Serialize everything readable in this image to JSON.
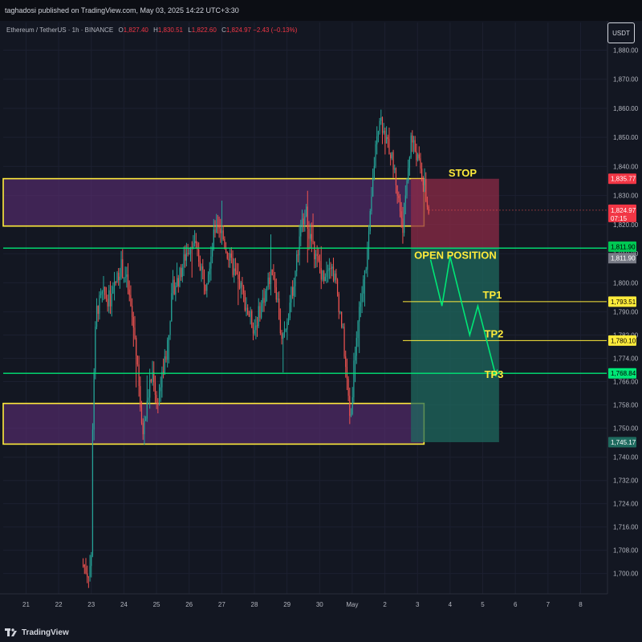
{
  "publisher": "taghadosi published on TradingView.com, May 03, 2025 14:22 UTC+3:30",
  "symbol": {
    "name": "Ethereum / TetherUS · 1h · BINANCE",
    "open_label": "O",
    "open": "1,827.40",
    "high_label": "H",
    "high": "1,830.51",
    "low_label": "L",
    "low": "1,822.60",
    "close_label": "C",
    "close": "1,824.97",
    "change": "−2.43 (−0.13%)"
  },
  "currency_button": "USDT",
  "brand": "TradingView",
  "colors": {
    "up": "#26a69a",
    "down": "#ef5350",
    "zone_purple": "#5b2d73",
    "zone_border": "#ffeb3b",
    "green_line": "#00e676",
    "stop_fill": "#8e2b47",
    "target_fill": "#1f6b5f",
    "annotation": "#ffeb3b"
  },
  "chart_data": {
    "type": "candlestick",
    "ylim": [
      1693,
      1884
    ],
    "y_ticks": [
      "1,700.00",
      "1,708.00",
      "1,716.00",
      "1,724.00",
      "1,732.00",
      "1,740.00",
      "1,750.00",
      "1,758.00",
      "1,766.00",
      "1,774.00",
      "1,782.00",
      "1,790.00",
      "1,800.00",
      "1,810.00",
      "1,820.00",
      "1,830.00",
      "1,840.00",
      "1,850.00",
      "1,860.00",
      "1,870.00",
      "1,880.00"
    ],
    "x_ticks": [
      "21",
      "22",
      "23",
      "24",
      "25",
      "26",
      "27",
      "28",
      "29",
      "30",
      "May",
      "2",
      "3",
      "4",
      "5",
      "6",
      "7",
      "8"
    ],
    "x_range": [
      20.3,
      38.8
    ],
    "x_tick_positions": [
      21,
      22,
      23,
      24,
      25,
      26,
      27,
      28,
      29,
      30,
      31,
      32,
      33,
      34,
      35,
      36,
      37,
      38
    ],
    "candles": {
      "start_day": 22.75,
      "step_days": 0.0417,
      "path": [
        [
          22.75,
          1703
        ],
        [
          22.9,
          1700
        ],
        [
          23.0,
          1705
        ],
        [
          23.05,
          1760
        ],
        [
          23.15,
          1790
        ],
        [
          23.35,
          1796
        ],
        [
          23.6,
          1794
        ],
        [
          23.9,
          1806
        ],
        [
          24.1,
          1800
        ],
        [
          24.2,
          1792
        ],
        [
          24.35,
          1780
        ],
        [
          24.45,
          1768
        ],
        [
          24.55,
          1748
        ],
        [
          24.65,
          1752
        ],
        [
          24.75,
          1762
        ],
        [
          24.9,
          1770
        ],
        [
          25.0,
          1758
        ],
        [
          25.15,
          1766
        ],
        [
          25.3,
          1776
        ],
        [
          25.5,
          1798
        ],
        [
          25.7,
          1802
        ],
        [
          25.9,
          1810
        ],
        [
          26.1,
          1815
        ],
        [
          26.3,
          1808
        ],
        [
          26.5,
          1800
        ],
        [
          26.7,
          1812
        ],
        [
          26.85,
          1822
        ],
        [
          27.0,
          1817
        ],
        [
          27.2,
          1809
        ],
        [
          27.4,
          1803
        ],
        [
          27.6,
          1798
        ],
        [
          27.8,
          1790
        ],
        [
          28.0,
          1784
        ],
        [
          28.2,
          1792
        ],
        [
          28.4,
          1799
        ],
        [
          28.55,
          1805
        ],
        [
          28.7,
          1795
        ],
        [
          28.85,
          1778
        ],
        [
          29.0,
          1788
        ],
        [
          29.2,
          1800
        ],
        [
          29.4,
          1816
        ],
        [
          29.55,
          1826
        ],
        [
          29.7,
          1816
        ],
        [
          29.9,
          1808
        ],
        [
          30.1,
          1802
        ],
        [
          30.3,
          1808
        ],
        [
          30.5,
          1800
        ],
        [
          30.7,
          1784
        ],
        [
          30.85,
          1764
        ],
        [
          30.95,
          1752
        ],
        [
          31.05,
          1772
        ],
        [
          31.2,
          1790
        ],
        [
          31.35,
          1800
        ],
        [
          31.5,
          1814
        ],
        [
          31.65,
          1838
        ],
        [
          31.75,
          1852
        ],
        [
          31.85,
          1858
        ],
        [
          32.0,
          1850
        ],
        [
          32.15,
          1846
        ],
        [
          32.3,
          1838
        ],
        [
          32.45,
          1826
        ],
        [
          32.55,
          1820
        ],
        [
          32.65,
          1832
        ],
        [
          32.8,
          1850
        ],
        [
          32.95,
          1845
        ],
        [
          33.1,
          1838
        ],
        [
          33.2,
          1834
        ],
        [
          33.3,
          1826
        ],
        [
          33.35,
          1824.97
        ]
      ],
      "seed": 7
    },
    "zones": [
      {
        "name": "upper-supply-zone",
        "top": 1835.8,
        "bottom": 1819.5,
        "x0": 20.3,
        "x1": 33.2
      },
      {
        "name": "lower-demand-zone",
        "top": 1758.5,
        "bottom": 1744.5,
        "x0": 20.3,
        "x1": 33.2
      }
    ],
    "levels": [
      {
        "name": "open-position-level",
        "value": 1811.9,
        "color": "#00e676",
        "label": "1,811.90"
      },
      {
        "name": "tp3-level",
        "value": 1768.84,
        "color": "#00e676",
        "label": "1,768.84"
      }
    ],
    "position": {
      "entry": 1811.9,
      "stop": 1835.77,
      "target": 1745.17,
      "x0": 32.8,
      "x1": 35.5,
      "stop_label": "STOP",
      "entry_label": "OPEN POSITION",
      "stop_price_tag": "1,835.77",
      "target_price_tag": "1,745.17",
      "entry_price_tag": "1,811.90"
    },
    "targets": [
      {
        "name": "TP1",
        "value": 1793.51,
        "label": "TP1",
        "price_tag": "1,793.51",
        "x0": 32.55
      },
      {
        "name": "TP2",
        "value": 1780.1,
        "label": "TP2",
        "price_tag": "1,780.10",
        "x0": 32.55
      }
    ],
    "zigzag": [
      [
        33.4,
        1808
      ],
      [
        33.75,
        1792
      ],
      [
        34.0,
        1809
      ],
      [
        34.6,
        1782
      ],
      [
        34.85,
        1792
      ],
      [
        35.4,
        1768
      ]
    ],
    "current_price": {
      "value": 1824.97,
      "label": "1,824.97",
      "countdown": "07:15",
      "x": 33.35
    },
    "tp3_label": "TP3"
  }
}
